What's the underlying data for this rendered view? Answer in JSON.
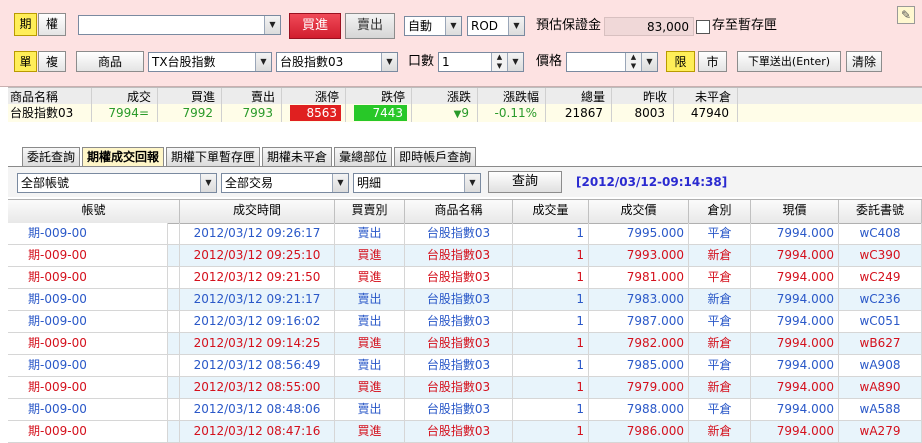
{
  "order": {
    "mode_options": [
      "期",
      "權"
    ],
    "buy_label": "買進",
    "sell_label": "賣出",
    "account_value": "",
    "condition": "自動",
    "order_type": "ROD",
    "margin_label": "預估保證金",
    "margin_value": "83,000",
    "save_checkbox_label": "存至暫存匣",
    "single_label": "單",
    "multi_label": "複",
    "product_button": "商品",
    "product_select": "TX台股指數",
    "contract_select": "台股指數03",
    "qty_label": "口數",
    "qty_value": "1",
    "price_label": "價格",
    "price_value": "",
    "limit_label": "限",
    "market_label": "市",
    "submit_label": "下單送出(Enter)",
    "clear_label": "清除"
  },
  "quote": {
    "headers": [
      "商品名稱",
      "成交",
      "買進",
      "賣出",
      "漲停",
      "跌停",
      "漲跌",
      "漲跌幅",
      "總量",
      "昨收",
      "未平倉"
    ],
    "row": {
      "name": "台股指數03",
      "last": "7994=",
      "bid": "7992",
      "ask": "7993",
      "limit_up": "8563",
      "limit_down": "7443",
      "change": "9",
      "change_pct": "-0.11%",
      "volume": "21867",
      "prev_close": "8003",
      "open_interest": "47940"
    }
  },
  "tabs": [
    "委託查詢",
    "期權成交回報",
    "期權下單暫存匣",
    "期權未平倉",
    "彙總部位",
    "即時帳戶查詢"
  ],
  "filters": {
    "account": "全部帳號",
    "trade": "全部交易",
    "detail": "明細",
    "query_label": "查詢",
    "timestamp": "[2012/03/12-09:14:38]"
  },
  "table": {
    "headers": [
      "帳號",
      "成交時間",
      "買賣別",
      "商品名稱",
      "成交量",
      "成交價",
      "倉別",
      "現價",
      "委託書號"
    ],
    "rows": [
      {
        "account": "期-009-00",
        "time": "2012/03/12 09:26:17",
        "side": "賣出",
        "product": "台股指數03",
        "qty": "1",
        "price": "7995.000",
        "pos": "平倉",
        "now": "7994.000",
        "order_no": "wC408",
        "color": "blue"
      },
      {
        "account": "期-009-00",
        "time": "2012/03/12 09:25:10",
        "side": "買進",
        "product": "台股指數03",
        "qty": "1",
        "price": "7993.000",
        "pos": "新倉",
        "now": "7994.000",
        "order_no": "wC390",
        "color": "red"
      },
      {
        "account": "期-009-00",
        "time": "2012/03/12 09:21:50",
        "side": "買進",
        "product": "台股指數03",
        "qty": "1",
        "price": "7981.000",
        "pos": "平倉",
        "now": "7994.000",
        "order_no": "wC249",
        "color": "red"
      },
      {
        "account": "期-009-00",
        "time": "2012/03/12 09:21:17",
        "side": "賣出",
        "product": "台股指數03",
        "qty": "1",
        "price": "7983.000",
        "pos": "新倉",
        "now": "7994.000",
        "order_no": "wC236",
        "color": "blue"
      },
      {
        "account": "期-009-00",
        "time": "2012/03/12 09:16:02",
        "side": "賣出",
        "product": "台股指數03",
        "qty": "1",
        "price": "7987.000",
        "pos": "平倉",
        "now": "7994.000",
        "order_no": "wC051",
        "color": "blue"
      },
      {
        "account": "期-009-00",
        "time": "2012/03/12 09:14:25",
        "side": "買進",
        "product": "台股指數03",
        "qty": "1",
        "price": "7982.000",
        "pos": "新倉",
        "now": "7994.000",
        "order_no": "wB627",
        "color": "red"
      },
      {
        "account": "期-009-00",
        "time": "2012/03/12 08:56:49",
        "side": "賣出",
        "product": "台股指數03",
        "qty": "1",
        "price": "7985.000",
        "pos": "平倉",
        "now": "7994.000",
        "order_no": "wA908",
        "color": "blue"
      },
      {
        "account": "期-009-00",
        "time": "2012/03/12 08:55:00",
        "side": "買進",
        "product": "台股指數03",
        "qty": "1",
        "price": "7979.000",
        "pos": "新倉",
        "now": "7994.000",
        "order_no": "wA890",
        "color": "red"
      },
      {
        "account": "期-009-00",
        "time": "2012/03/12 08:48:06",
        "side": "賣出",
        "product": "台股指數03",
        "qty": "1",
        "price": "7988.000",
        "pos": "平倉",
        "now": "7994.000",
        "order_no": "wA588",
        "color": "blue"
      },
      {
        "account": "期-009-00",
        "time": "2012/03/12 08:47:16",
        "side": "買進",
        "product": "台股指數03",
        "qty": "1",
        "price": "7986.000",
        "pos": "新倉",
        "now": "7994.000",
        "order_no": "wA279",
        "color": "red"
      }
    ]
  },
  "colors": {
    "panel_bg": "#fde2e2",
    "limit_up_bg": "#e02020",
    "limit_down_bg": "#28c828",
    "buy_red": "#d4101c",
    "sell_blue": "#2a58c8",
    "highlight_yellow": "#ffee58"
  },
  "icons": {
    "edit": "pencil-icon",
    "down_arrow": "down-triangle-icon"
  }
}
